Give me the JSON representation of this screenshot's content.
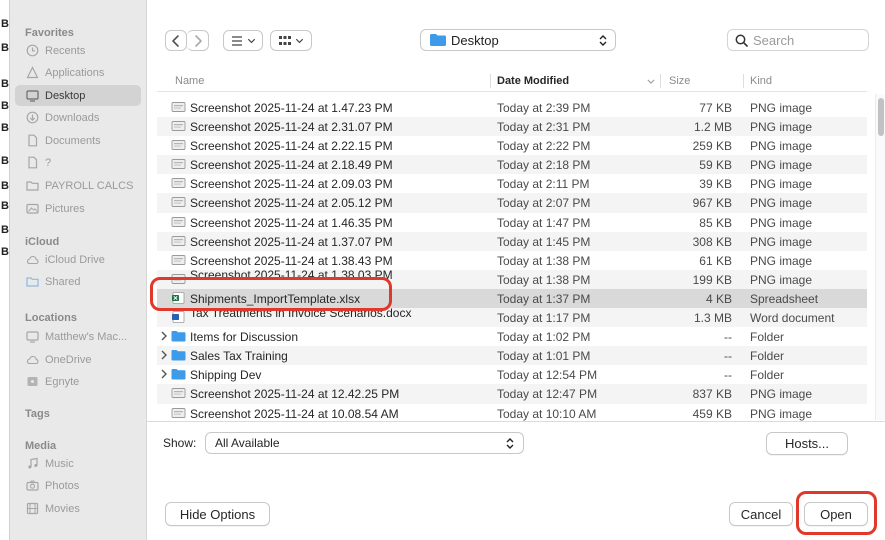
{
  "gutter": {
    "letters": [
      "B",
      "B",
      "B",
      "B",
      "B",
      "B",
      "B",
      "B",
      "B",
      "B"
    ]
  },
  "sidebar": {
    "sections": [
      {
        "title": "Favorites",
        "items": [
          {
            "label": "Recents",
            "icon": "clock-icon",
            "active": false
          },
          {
            "label": "Applications",
            "icon": "applications-icon",
            "active": false
          },
          {
            "label": "Desktop",
            "icon": "desktop-icon",
            "active": true
          },
          {
            "label": "Downloads",
            "icon": "download-icon",
            "active": false
          },
          {
            "label": "Documents",
            "icon": "document-icon",
            "active": false
          },
          {
            "label": "?",
            "icon": "document-icon",
            "active": false
          },
          {
            "label": "PAYROLL CALCS",
            "icon": "folder-icon",
            "active": false
          },
          {
            "label": "Pictures",
            "icon": "pictures-icon",
            "active": false
          }
        ]
      },
      {
        "title": "iCloud",
        "items": [
          {
            "label": "iCloud Drive",
            "icon": "cloud-icon",
            "active": false
          },
          {
            "label": "Shared",
            "icon": "shared-folder-icon",
            "active": false
          }
        ]
      },
      {
        "title": "Locations",
        "items": [
          {
            "label": "Matthew's Mac...",
            "icon": "computer-icon",
            "active": false
          },
          {
            "label": "OneDrive",
            "icon": "cloud-icon",
            "active": false
          },
          {
            "label": "Egnyte",
            "icon": "disk-icon",
            "active": false
          }
        ]
      },
      {
        "title": "Tags",
        "items": []
      },
      {
        "title": "Media",
        "items": [
          {
            "label": "Music",
            "icon": "music-icon",
            "active": false
          },
          {
            "label": "Photos",
            "icon": "camera-icon",
            "active": false
          },
          {
            "label": "Movies",
            "icon": "film-icon",
            "active": false
          }
        ]
      }
    ]
  },
  "toolbar": {
    "location": "Desktop",
    "search_placeholder": "Search"
  },
  "columns": {
    "name": "Name",
    "date": "Date Modified",
    "size": "Size",
    "kind": "Kind"
  },
  "files": [
    {
      "name": "Screenshot 2025-11-24 at 1.47.23 PM",
      "date": "Today at 2:39 PM",
      "size": "77 KB",
      "kind": "PNG image",
      "type": "image",
      "selected": false,
      "folder": false
    },
    {
      "name": "Screenshot 2025-11-24 at 2.31.07 PM",
      "date": "Today at 2:31 PM",
      "size": "1.2 MB",
      "kind": "PNG image",
      "type": "image",
      "selected": false,
      "folder": false
    },
    {
      "name": "Screenshot 2025-11-24 at 2.22.15 PM",
      "date": "Today at 2:22 PM",
      "size": "259 KB",
      "kind": "PNG image",
      "type": "image",
      "selected": false,
      "folder": false
    },
    {
      "name": "Screenshot 2025-11-24 at 2.18.49 PM",
      "date": "Today at 2:18 PM",
      "size": "59 KB",
      "kind": "PNG image",
      "type": "image",
      "selected": false,
      "folder": false
    },
    {
      "name": "Screenshot 2025-11-24 at 2.09.03 PM",
      "date": "Today at 2:11 PM",
      "size": "39 KB",
      "kind": "PNG image",
      "type": "image",
      "selected": false,
      "folder": false
    },
    {
      "name": "Screenshot 2025-11-24 at 2.05.12 PM",
      "date": "Today at 2:07 PM",
      "size": "967 KB",
      "kind": "PNG image",
      "type": "image",
      "selected": false,
      "folder": false
    },
    {
      "name": "Screenshot 2025-11-24 at 1.46.35 PM",
      "date": "Today at 1:47 PM",
      "size": "85 KB",
      "kind": "PNG image",
      "type": "image",
      "selected": false,
      "folder": false
    },
    {
      "name": "Screenshot 2025-11-24 at 1.37.07 PM",
      "date": "Today at 1:45 PM",
      "size": "308 KB",
      "kind": "PNG image",
      "type": "image",
      "selected": false,
      "folder": false
    },
    {
      "name": "Screenshot 2025-11-24 at 1.38.43 PM",
      "date": "Today at 1:38 PM",
      "size": "61 KB",
      "kind": "PNG image",
      "type": "image",
      "selected": false,
      "folder": false
    },
    {
      "name": "Screenshot 2025-11-24 at 1.38.03 PM",
      "date": "Today at 1:38 PM",
      "size": "199 KB",
      "kind": "PNG image",
      "type": "image",
      "selected": false,
      "folder": false,
      "cut": true
    },
    {
      "name": "Shipments_ImportTemplate.xlsx",
      "date": "Today at 1:37 PM",
      "size": "4 KB",
      "kind": "Spreadsheet",
      "type": "xlsx",
      "selected": true,
      "folder": false
    },
    {
      "name": "Tax Treatments in Invoice Scenarios.docx",
      "date": "Today at 1:17 PM",
      "size": "1.3 MB",
      "kind": "Word document",
      "type": "docx",
      "selected": false,
      "folder": false,
      "cut": true
    },
    {
      "name": "Items for Discussion",
      "date": "Today at 1:02 PM",
      "size": "--",
      "kind": "Folder",
      "type": "folder",
      "selected": false,
      "folder": true
    },
    {
      "name": "Sales Tax Training",
      "date": "Today at 1:01 PM",
      "size": "--",
      "kind": "Folder",
      "type": "folder",
      "selected": false,
      "folder": true
    },
    {
      "name": "Shipping Dev",
      "date": "Today at 12:54 PM",
      "size": "--",
      "kind": "Folder",
      "type": "folder",
      "selected": false,
      "folder": true
    },
    {
      "name": "Screenshot 2025-11-24 at 12.42.25 PM",
      "date": "Today at 12:47 PM",
      "size": "837 KB",
      "kind": "PNG image",
      "type": "image",
      "selected": false,
      "folder": false
    },
    {
      "name": "Screenshot 2025-11-24 at 10.08.54 AM",
      "date": "Today at 10:10 AM",
      "size": "459 KB",
      "kind": "PNG image",
      "type": "image",
      "selected": false,
      "folder": false
    }
  ],
  "options": {
    "show_label": "Show:",
    "show_value": "All Available",
    "hosts_label": "Hosts..."
  },
  "footer": {
    "hide_options": "Hide Options",
    "cancel": "Cancel",
    "open": "Open"
  },
  "colors": {
    "highlight": "#e0392b",
    "folder": "#3d9be9",
    "selection": "#d9d9d9"
  }
}
